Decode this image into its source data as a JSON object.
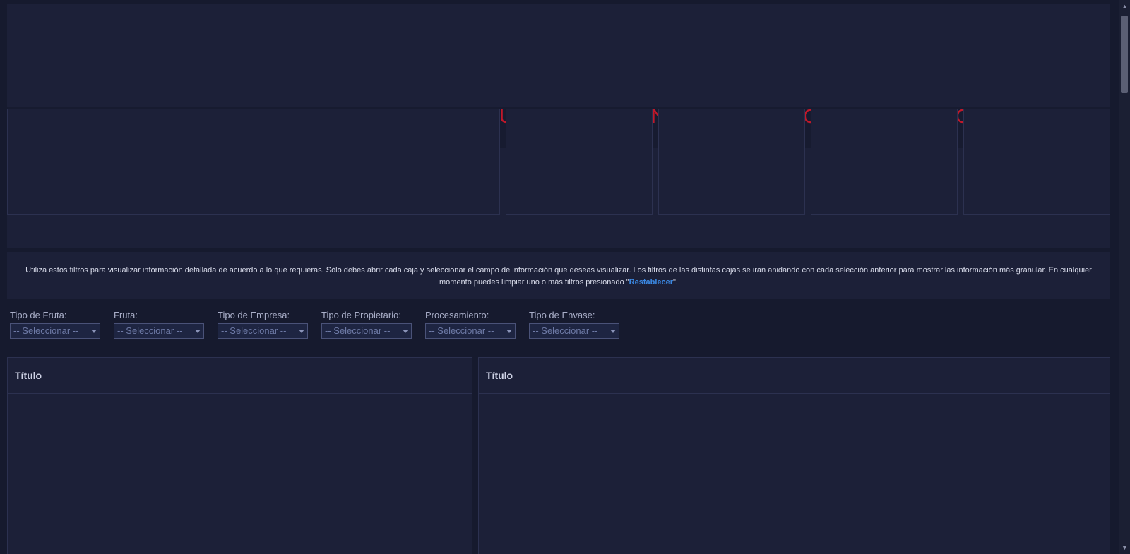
{
  "banner": {
    "glyphs": [
      "U",
      "N",
      "C",
      "C"
    ]
  },
  "info": {
    "text_before": "Utiliza estos filtros para visualizar información detallada de acuerdo a lo que requieras. Sólo debes abrir cada caja y seleccionar el campo de información que deseas visualizar. Los filtros de las distintas cajas se irán anidando con cada selección anterior para mostrar las información más granular. En cualquier momento puedes limpiar uno o más filtros presionado \"",
    "link": "Restablecer",
    "text_after": "\"."
  },
  "filters": [
    {
      "label": "Tipo de Fruta:",
      "value": "-- Seleccionar --"
    },
    {
      "label": "Fruta:",
      "value": "-- Seleccionar --"
    },
    {
      "label": "Tipo de Empresa:",
      "value": "-- Seleccionar --"
    },
    {
      "label": "Tipo de Propietario:",
      "value": "-- Seleccionar --"
    },
    {
      "label": "Procesamiento:",
      "value": "-- Seleccionar --"
    },
    {
      "label": "Tipo de Envase:",
      "value": "-- Seleccionar --"
    }
  ],
  "panels": [
    {
      "title": "Título"
    },
    {
      "title": "Título"
    }
  ],
  "scrollbar": {
    "up_icon": "chevron-up-icon",
    "down_icon": "chevron-down-icon"
  },
  "colors": {
    "background": "#161a2e",
    "panel": "#1c2038",
    "accent_red": "#c2182a",
    "link_blue": "#3b8ae6"
  }
}
